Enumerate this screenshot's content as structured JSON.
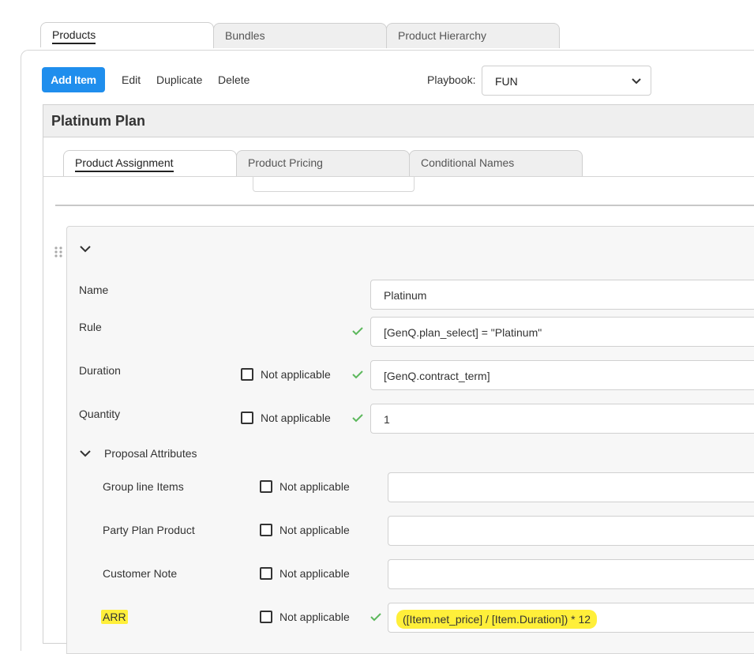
{
  "tabs": [
    {
      "label": "Products",
      "active": true
    },
    {
      "label": "Bundles",
      "active": false
    },
    {
      "label": "Product Hierarchy",
      "active": false
    }
  ],
  "toolbar": {
    "add_item": "Add Item",
    "edit": "Edit",
    "duplicate": "Duplicate",
    "delete": "Delete",
    "playbook_label": "Playbook:",
    "playbook_value": "FUN"
  },
  "item_title": "Platinum Plan",
  "subtabs": [
    {
      "label": "Product Assignment",
      "active": true
    },
    {
      "label": "Product Pricing",
      "active": false
    },
    {
      "label": "Conditional Names",
      "active": false
    }
  ],
  "form": {
    "name_label": "Name",
    "name_value": "Platinum",
    "rule_label": "Rule",
    "rule_value": "[GenQ.plan_select] = \"Platinum\"",
    "duration_label": "Duration",
    "duration_value": "[GenQ.contract_term]",
    "quantity_label": "Quantity",
    "quantity_value": "1",
    "not_applicable": "Not applicable",
    "proposal_attributes": "Proposal Attributes",
    "attributes": [
      {
        "label": "Group line Items",
        "value": ""
      },
      {
        "label": "Party Plan Product",
        "value": ""
      },
      {
        "label": "Customer Note",
        "value": ""
      },
      {
        "label": "ARR",
        "value": "([Item.net_price] / [Item.Duration]) * 12"
      }
    ]
  },
  "colors": {
    "accent": "#1f8eed",
    "check": "#5cb85c",
    "highlight": "#ffef3a"
  }
}
